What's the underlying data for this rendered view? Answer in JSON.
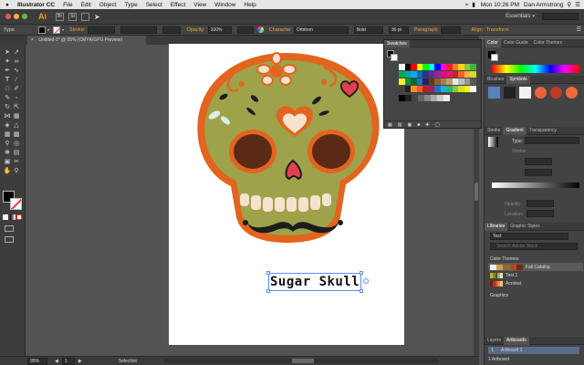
{
  "menubar": {
    "app_name": "Illustrator CC",
    "items": [
      "File",
      "Edit",
      "Object",
      "Type",
      "Select",
      "Effect",
      "View",
      "Window",
      "Help"
    ],
    "clock": "Mon 10:26 PM",
    "user": "Dan Armstrong"
  },
  "appbar": {
    "logo": "Ai",
    "workspace": "Essentials"
  },
  "control_bar": {
    "tool_label": "Type",
    "stroke_label": "Stroke:",
    "opacity_label": "Opacity:",
    "opacity_value": "100%",
    "character_label": "Character",
    "font_name": "Orbitron",
    "font_style": "Bold",
    "font_size": "36 pt",
    "paragraph_label": "Paragraph",
    "align_label": "Align",
    "transform_label": "Transform"
  },
  "document_tab": "Untitled-1* @ 95% (CMYK/GPU Preview)",
  "artwork": {
    "title_text": "Sugar Skull"
  },
  "swatches_panel": {
    "title": "Swatches"
  },
  "color_panel": {
    "tabs": [
      "Color",
      "Color Guide",
      "Color Themes"
    ]
  },
  "brushes_panel": {
    "tabs": [
      "Brushes",
      "Symbols"
    ]
  },
  "gradient_panel": {
    "tabs": [
      "Stroke",
      "Gradient",
      "Transparency"
    ],
    "type_label": "Type:",
    "stroke_label": "Stroke:",
    "opacity_label": "Opacity:",
    "location_label": "Location:"
  },
  "libraries_panel": {
    "tabs": [
      "Libraries",
      "Graphic Styles"
    ],
    "library_name": "Test",
    "search_placeholder": "Search Adobe Stock",
    "section_color_themes": "Color Themes",
    "themes": [
      {
        "name": "Fall Catalog",
        "colors": [
          "#f3efe3",
          "#c9a14a",
          "#8a6d3b",
          "#b04a20",
          "#6b2a10"
        ]
      },
      {
        "name": "Test 1",
        "colors": [
          "#d9a441",
          "#7c8a3c",
          "#3a5a2a",
          "#c2a36b",
          "#f0e3c0"
        ]
      },
      {
        "name": "Acrobat",
        "colors": [
          "#7a1d12",
          "#b8321f",
          "#e04a2a",
          "#f08a3a",
          "#f6c27a"
        ]
      }
    ],
    "section_graphics": "Graphics"
  },
  "artboards_panel": {
    "tabs": [
      "Layers",
      "Artboards"
    ],
    "row_index": "1",
    "row_name": "Artboard 1",
    "footer": "1 Artboard"
  },
  "statusbar": {
    "zoom": "95%",
    "page": "1",
    "tool": "Selection"
  },
  "colors": {
    "skull_green": "#9ea24b",
    "skull_orange": "#e2641f",
    "eye_brown": "#5a2a17",
    "nose_red": "#e2404f",
    "mint": "#dcefe6",
    "mustache": "#1c1c1c"
  }
}
